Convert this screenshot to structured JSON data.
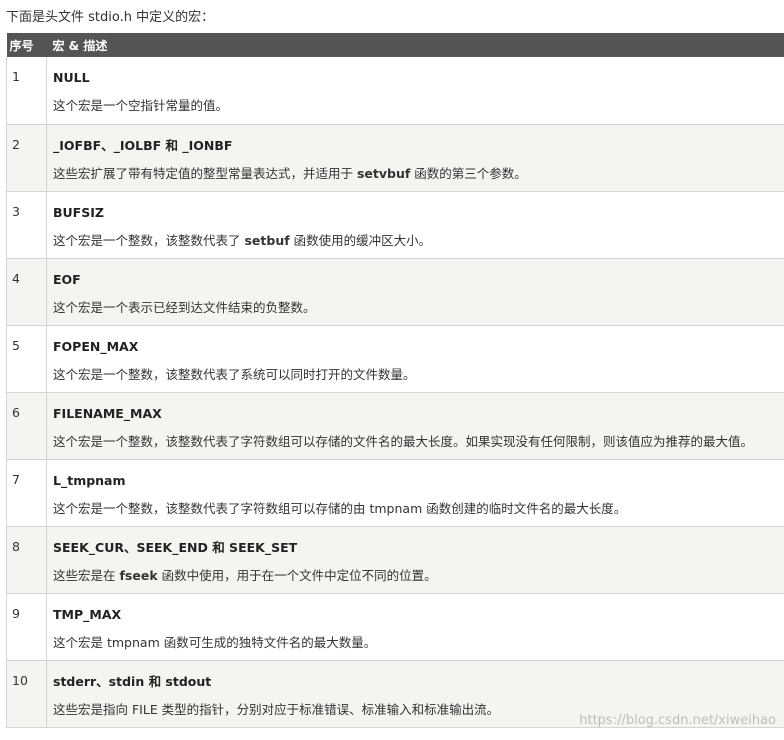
{
  "intro": "下面是头文件 stdio.h 中定义的宏：",
  "headers": {
    "index": "序号",
    "macro": "宏 & 描述"
  },
  "rows": [
    {
      "index": "1",
      "name": "NULL",
      "desc": "这个宏是一个空指针常量的值。"
    },
    {
      "index": "2",
      "name": "_IOFBF、_IOLBF 和 _IONBF",
      "desc_before": "这些宏扩展了带有特定值的整型常量表达式，并适用于 ",
      "desc_bold": "setvbuf",
      "desc_after": " 函数的第三个参数。"
    },
    {
      "index": "3",
      "name": "BUFSIZ",
      "desc_before": "这个宏是一个整数，该整数代表了 ",
      "desc_bold": "setbuf",
      "desc_after": " 函数使用的缓冲区大小。"
    },
    {
      "index": "4",
      "name": "EOF",
      "desc": "这个宏是一个表示已经到达文件结束的负整数。"
    },
    {
      "index": "5",
      "name": "FOPEN_MAX",
      "desc": "这个宏是一个整数，该整数代表了系统可以同时打开的文件数量。"
    },
    {
      "index": "6",
      "name": "FILENAME_MAX",
      "desc": "这个宏是一个整数，该整数代表了字符数组可以存储的文件名的最大长度。如果实现没有任何限制，则该值应为推荐的最大值。"
    },
    {
      "index": "7",
      "name": "L_tmpnam",
      "desc": "这个宏是一个整数，该整数代表了字符数组可以存储的由 tmpnam 函数创建的临时文件名的最大长度。"
    },
    {
      "index": "8",
      "name": "SEEK_CUR、SEEK_END 和 SEEK_SET",
      "desc_before": "这些宏是在 ",
      "desc_bold": "fseek",
      "desc_after": " 函数中使用，用于在一个文件中定位不同的位置。"
    },
    {
      "index": "9",
      "name": "TMP_MAX",
      "desc": "这个宏是 tmpnam 函数可生成的独特文件名的最大数量。"
    },
    {
      "index": "10",
      "name": "stderr、stdin 和 stdout",
      "desc": "这些宏是指向 FILE 类型的指针，分别对应于标准错误、标准输入和标准输出流。"
    }
  ],
  "watermark": "https://blog.csdn.net/xiweihao"
}
